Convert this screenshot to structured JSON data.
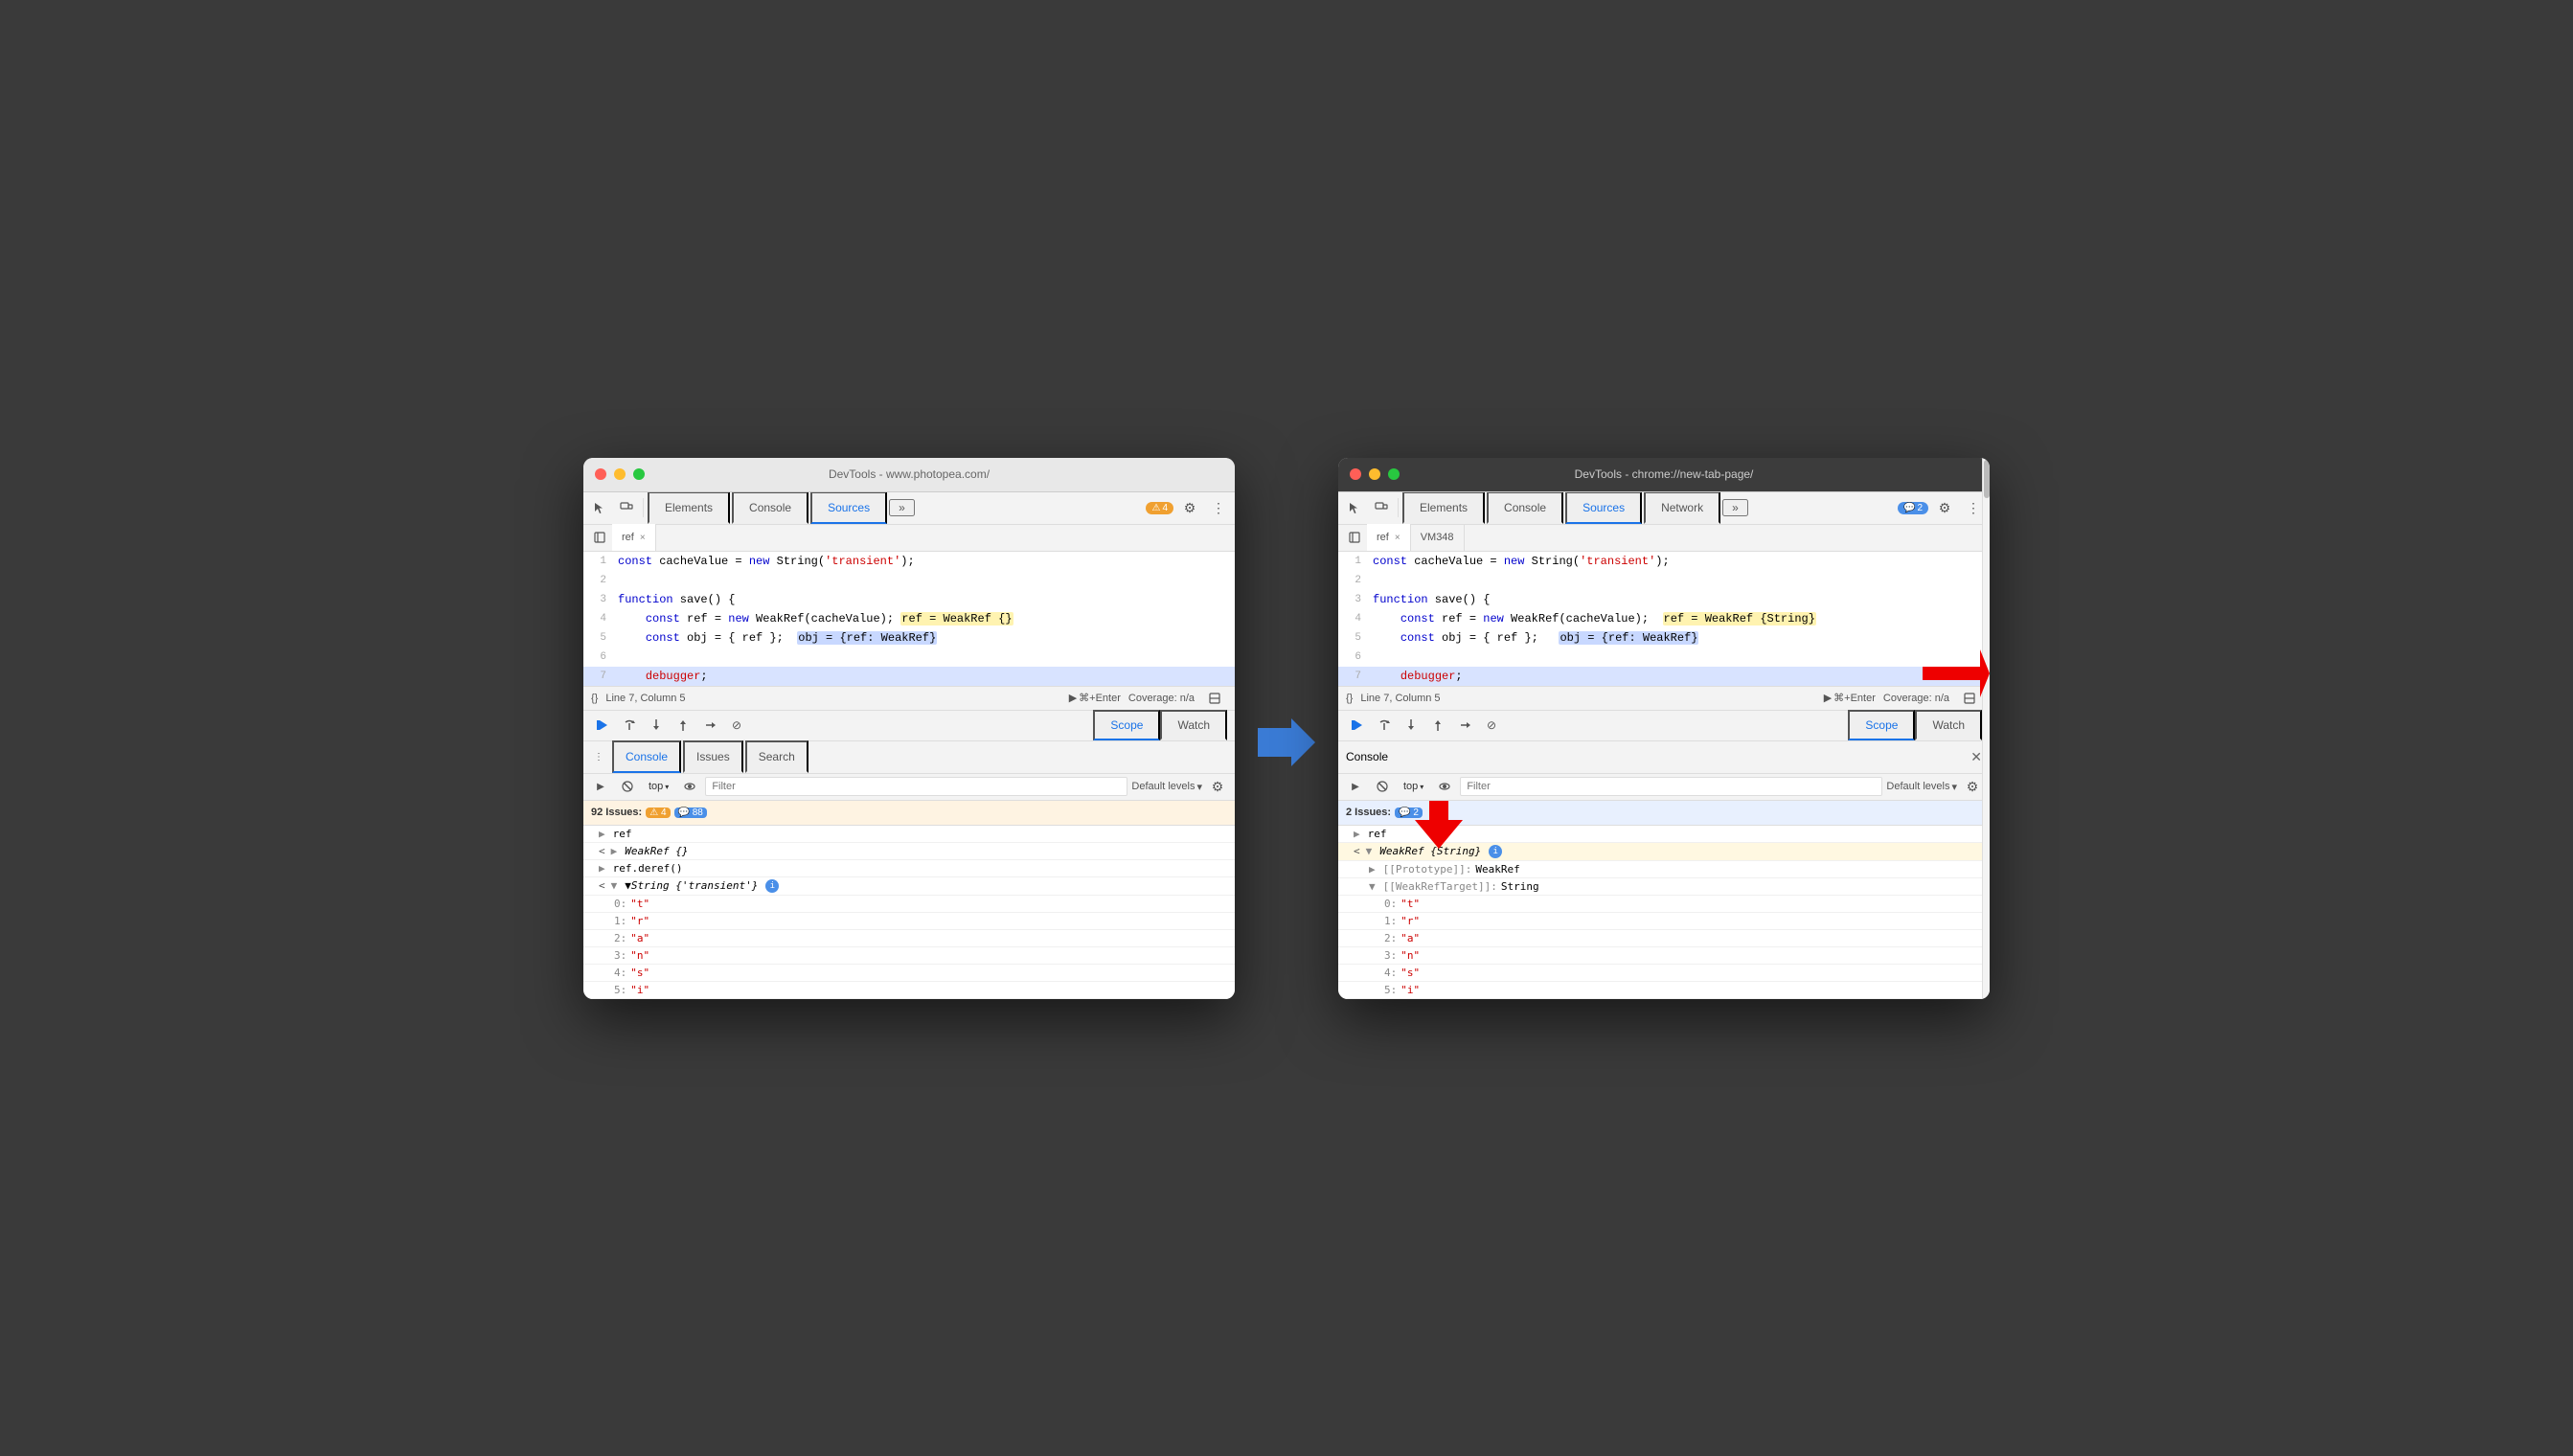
{
  "left_window": {
    "title": "DevTools - www.photopea.com/",
    "tabs": [
      "Elements",
      "Console",
      "Sources",
      "»"
    ],
    "active_tab": "Sources",
    "badge": "4",
    "file_tabs": [
      "ref",
      ""
    ],
    "code_lines": [
      {
        "num": 1,
        "content": "const cacheValue = new String('transient');"
      },
      {
        "num": 2,
        "content": ""
      },
      {
        "num": 3,
        "content": "function save() {"
      },
      {
        "num": 4,
        "content": "    const ref = new WeakRef(cacheValue); ",
        "highlight": "ref = WeakRef {}"
      },
      {
        "num": 5,
        "content": "    const obj = { ref };  ",
        "highlight2": "obj = {ref: WeakRef}"
      },
      {
        "num": 6,
        "content": ""
      },
      {
        "num": 7,
        "content": "    debugger;",
        "active": true
      }
    ],
    "status_bar": {
      "line_col": "Line 7, Column 5",
      "coverage": "Coverage: n/a"
    },
    "debug_tabs": [
      "Scope",
      "Watch"
    ],
    "active_debug_tab": "Scope",
    "console_tabs": [
      "Console",
      "Issues",
      "Search"
    ],
    "active_console_tab": "Console",
    "console_toolbar": {
      "filter_placeholder": "Filter",
      "levels": "Default levels",
      "top_label": "top"
    },
    "issues_bar": "92 Issues:  4  88",
    "console_entries": [
      {
        "type": "ref",
        "label": "ref"
      },
      {
        "type": "weakref",
        "label": "WeakRef {}",
        "expanded": false
      },
      {
        "type": "ref_deref",
        "label": "ref.deref()"
      },
      {
        "type": "string",
        "label": "String {'transient'}",
        "expanded": true
      },
      {
        "type": "prop",
        "indent": 1,
        "label": "0:",
        "val": "\"t\""
      },
      {
        "type": "prop",
        "indent": 1,
        "label": "1:",
        "val": "\"r\""
      },
      {
        "type": "prop",
        "indent": 1,
        "label": "2:",
        "val": "\"a\""
      },
      {
        "type": "prop",
        "indent": 1,
        "label": "3:",
        "val": "\"n\""
      },
      {
        "type": "prop",
        "indent": 1,
        "label": "4:",
        "val": "\"s\""
      },
      {
        "type": "prop",
        "indent": 1,
        "label": "5:",
        "val": "\"i\""
      }
    ]
  },
  "right_window": {
    "title": "DevTools - chrome://new-tab-page/",
    "tabs": [
      "Elements",
      "Console",
      "Sources",
      "Network",
      "»"
    ],
    "active_tab": "Sources",
    "badge": "2",
    "file_tabs": [
      "ref",
      "VM348"
    ],
    "code_lines": [
      {
        "num": 1,
        "content": "const cacheValue = new String('transient');"
      },
      {
        "num": 2,
        "content": ""
      },
      {
        "num": 3,
        "content": "function save() {"
      },
      {
        "num": 4,
        "content": "    const ref = new WeakRef(cacheValue);  ",
        "highlight": "ref = WeakRef {String}"
      },
      {
        "num": 5,
        "content": "    const obj = { ref };   ",
        "highlight2": "obj = {ref: WeakRef}"
      },
      {
        "num": 6,
        "content": ""
      },
      {
        "num": 7,
        "content": "    debugger;",
        "active": true
      }
    ],
    "status_bar": {
      "line_col": "Line 7, Column 5",
      "coverage": "Coverage: n/a"
    },
    "debug_tabs": [
      "Scope",
      "Watch"
    ],
    "active_debug_tab": "Scope",
    "console_header": "Console",
    "console_toolbar": {
      "filter_placeholder": "Filter",
      "levels": "Default levels",
      "top_label": "top"
    },
    "issues_bar": "2 Issues:  2",
    "console_entries": [
      {
        "type": "ref",
        "label": "ref"
      },
      {
        "type": "weakref_string",
        "label": "WeakRef {String}",
        "expanded": true,
        "info": true
      },
      {
        "type": "prop",
        "indent": 1,
        "label": "[[Prototype]]:",
        "val": "WeakRef"
      },
      {
        "type": "weakref_target",
        "indent": 1,
        "label": "[[WeakRefTarget]]:",
        "val": "String"
      },
      {
        "type": "prop",
        "indent": 2,
        "label": "0:",
        "val": "\"t\""
      },
      {
        "type": "prop",
        "indent": 2,
        "label": "1:",
        "val": "\"r\""
      },
      {
        "type": "prop",
        "indent": 2,
        "label": "2:",
        "val": "\"a\""
      },
      {
        "type": "prop",
        "indent": 2,
        "label": "3:",
        "val": "\"n\""
      },
      {
        "type": "prop",
        "indent": 2,
        "label": "4:",
        "val": "\"s\""
      },
      {
        "type": "prop",
        "indent": 2,
        "label": "5:",
        "val": "\"i\""
      }
    ]
  },
  "icons": {
    "close": "✕",
    "minimize": "—",
    "maximize": "⬤",
    "cursor": "↖",
    "panel": "⊟",
    "more": "»",
    "gear": "⚙",
    "kebab": "⋮",
    "play": "▶",
    "step_over": "↷",
    "step_into": "↓",
    "step_out": "↑",
    "step_back": "↩",
    "deactivate": "⊘",
    "clear": "🚫",
    "eye": "👁",
    "filter": "⊟",
    "expand": "▶",
    "collapse": "▼",
    "sub_expand": "▶",
    "sub_collapse": "▼",
    "run": "▶",
    "chevron_down": "▾"
  }
}
